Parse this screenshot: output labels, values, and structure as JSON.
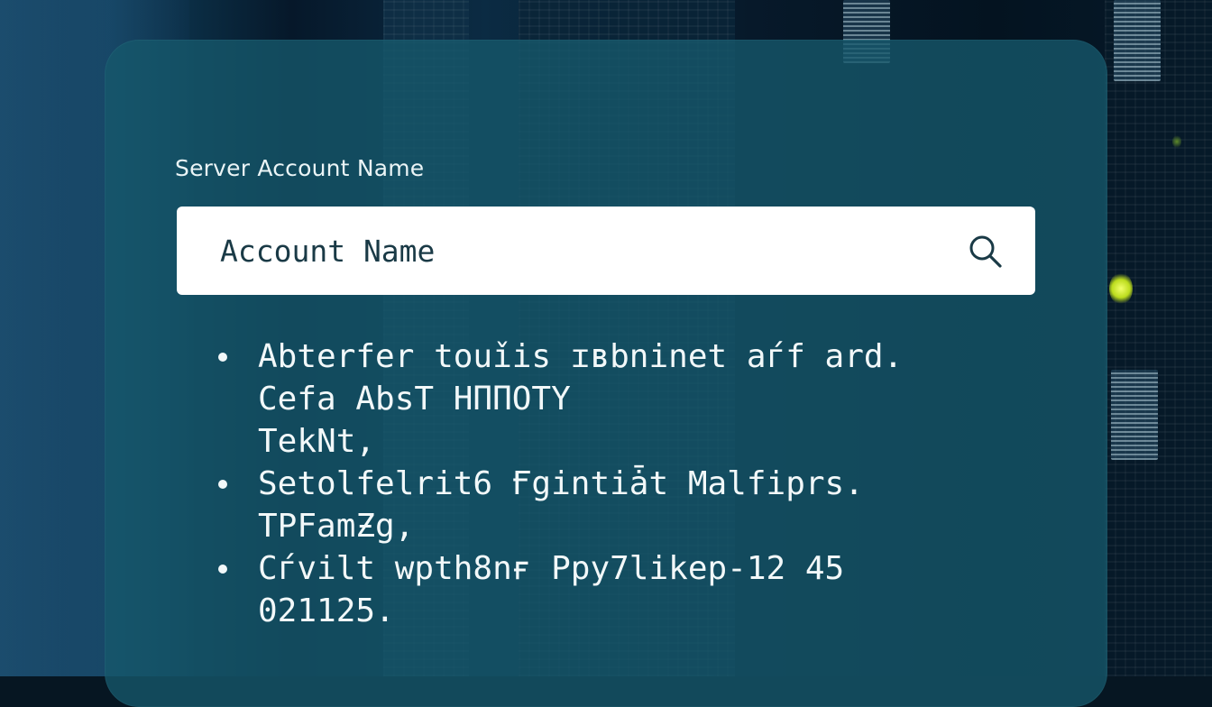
{
  "form": {
    "field_label": "Server Account Name",
    "search_placeholder": "Account Name",
    "search_value": ""
  },
  "icons": {
    "search": "search-icon",
    "bullet": "bullet-dot-icon"
  },
  "colors": {
    "panel": "#16586c",
    "input_bg": "#ffffff",
    "input_text": "#1a3a46",
    "text_light": "#f2f8f9",
    "led_accent": "#d4ef2a"
  },
  "bullets": [
    {
      "lines": [
        "Abterfer touǐis ɪʙbninet aѓf ard.",
        "Cefa AbsT HΠΠOTY",
        "TekNt,"
      ]
    },
    {
      "lines": [
        "Setolfelrit6 Ғgintiǡt Malfiprs.",
        "TPFamƵg,"
      ]
    },
    {
      "lines": [
        "Cѓvilt wpth8nғ Ppy7likep-12 45",
        "021125."
      ]
    }
  ]
}
